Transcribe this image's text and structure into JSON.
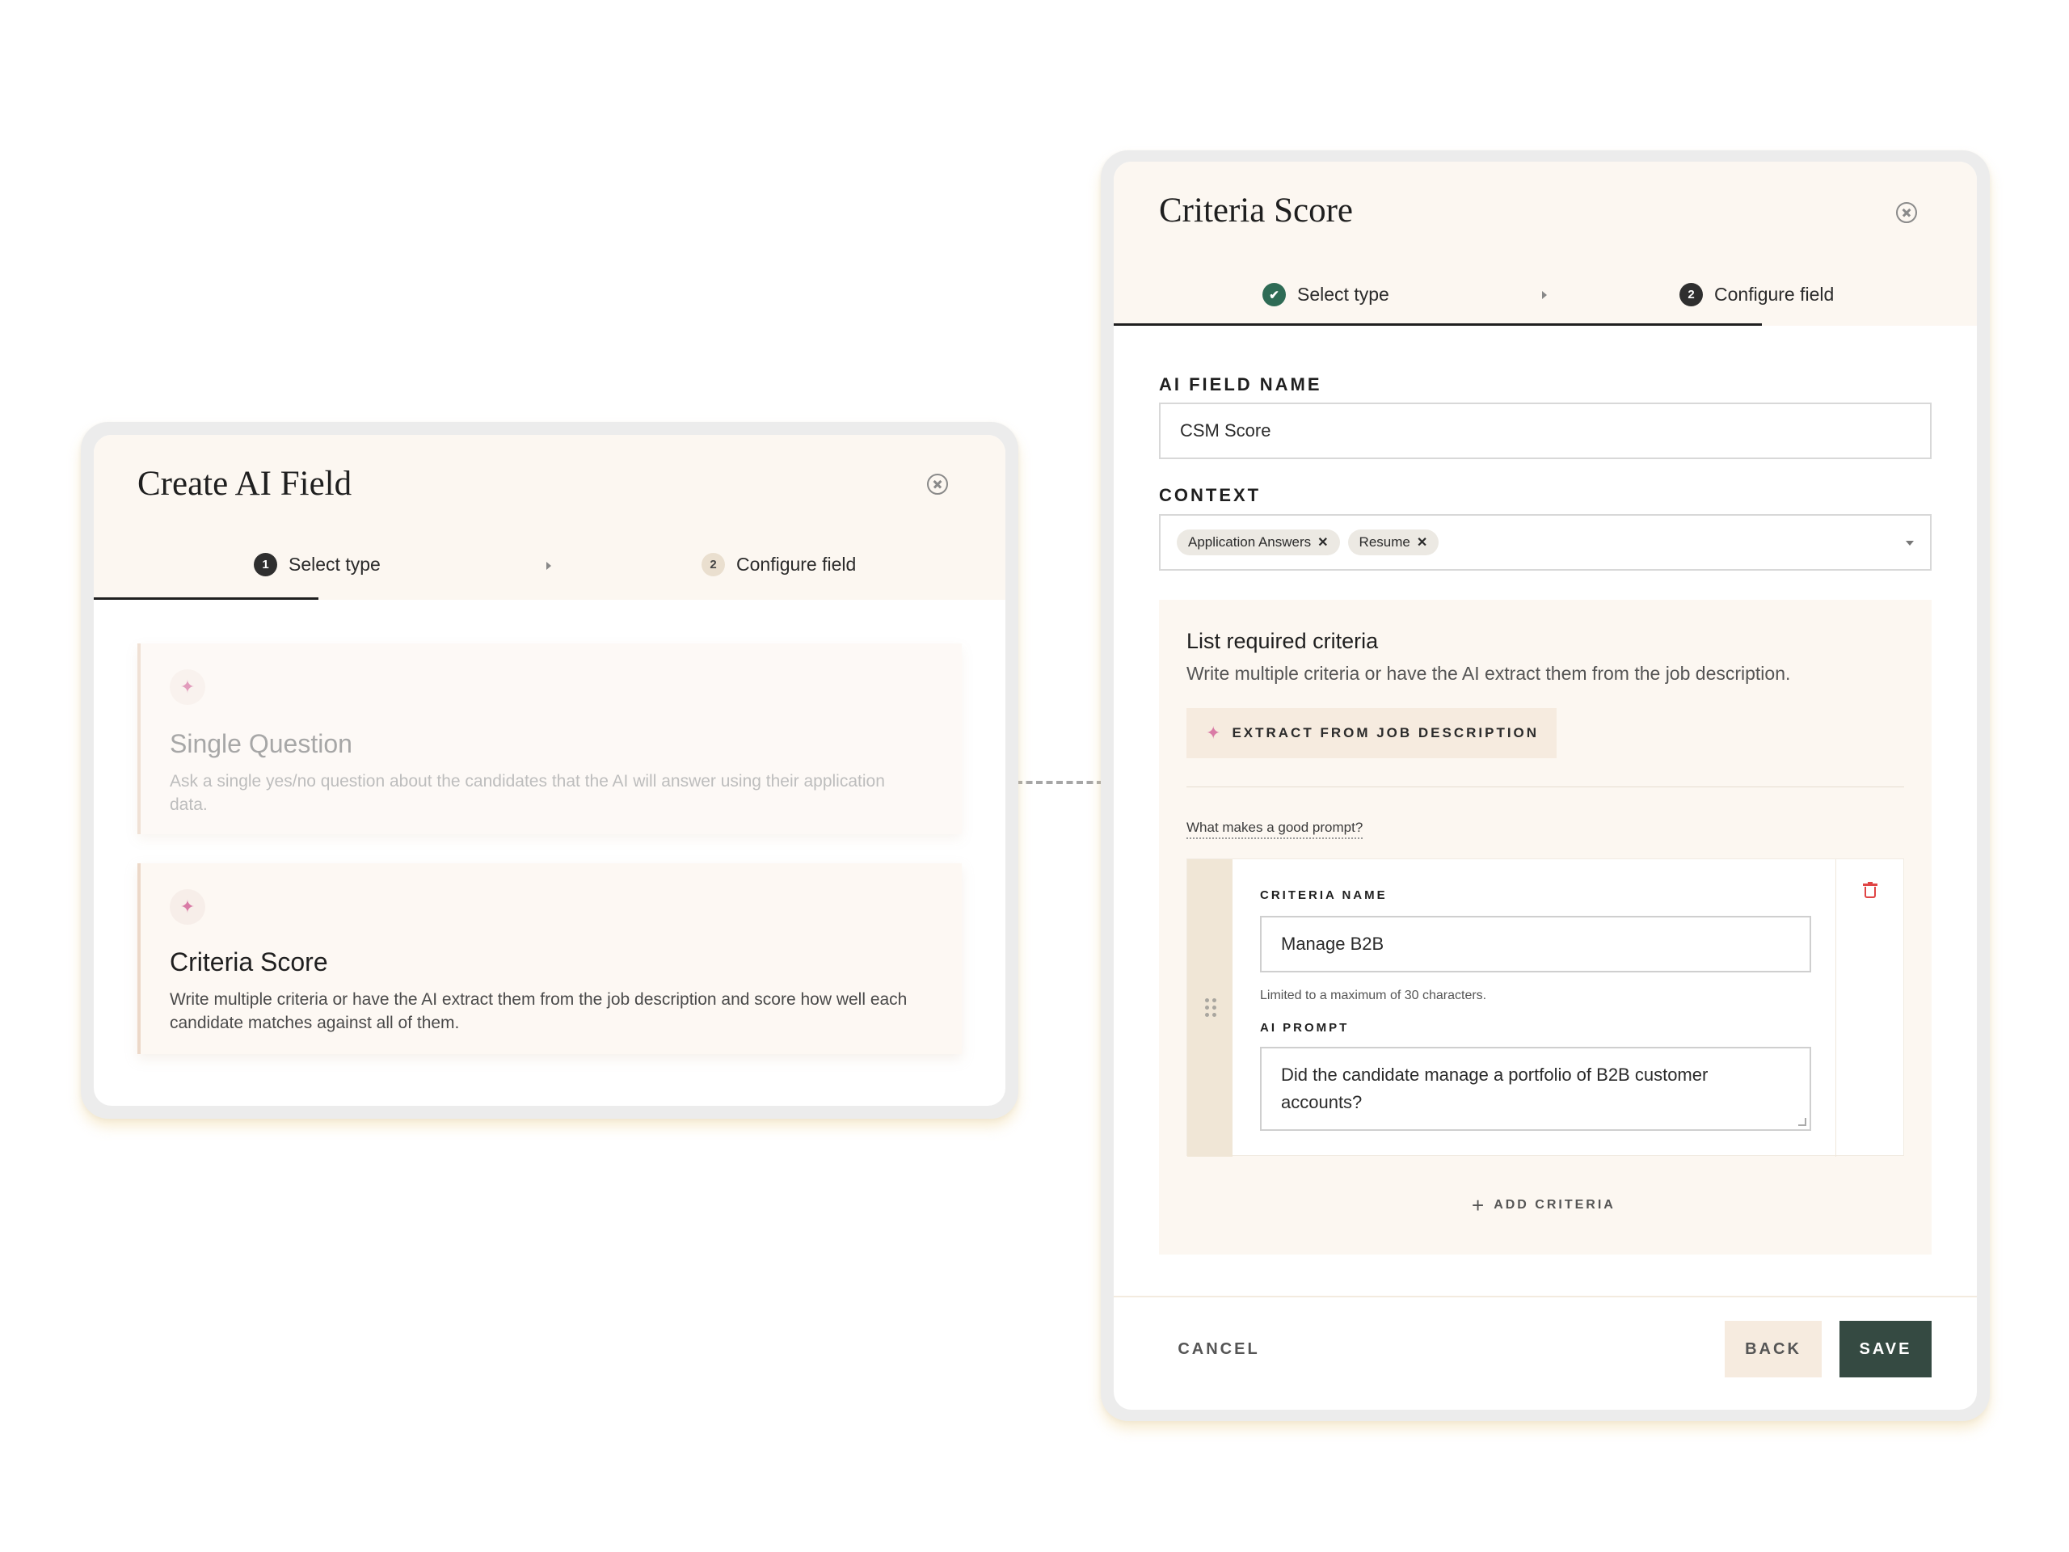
{
  "left_modal": {
    "title": "Create AI Field",
    "steps": [
      {
        "number": "1",
        "label": "Select type"
      },
      {
        "number": "2",
        "label": "Configure field"
      }
    ],
    "cards": [
      {
        "title": "Single Question",
        "description": "Ask a single yes/no question about the candidates that the AI will answer using their application data.",
        "icon": "sparkle-icon"
      },
      {
        "title": "Criteria Score",
        "description": "Write multiple criteria or have the AI extract them from the job description and score how well each candidate matches against all of them.",
        "icon": "sparkle-icon"
      }
    ]
  },
  "right_modal": {
    "title": "Criteria Score",
    "steps": [
      {
        "label": "Select type",
        "state": "done",
        "icon": "check-icon"
      },
      {
        "number": "2",
        "label": "Configure field",
        "state": "active"
      }
    ],
    "ai_field_name": {
      "label": "AI FIELD NAME",
      "value": "CSM Score"
    },
    "context": {
      "label": "CONTEXT",
      "chips": [
        "Application Answers",
        "Resume"
      ],
      "chip_remove_glyph": "✕"
    },
    "criteria_section": {
      "heading": "List required criteria",
      "description": "Write multiple criteria or have the AI extract them from the job description.",
      "extract_button": "EXTRACT FROM JOB DESCRIPTION",
      "help_link": "What makes a good prompt?",
      "criteria": [
        {
          "name_label": "CRITERIA NAME",
          "name_value": "Manage B2B",
          "name_hint": "Limited to a maximum of 30 characters.",
          "prompt_label": "AI PROMPT",
          "prompt_value": "Did the candidate manage a portfolio of B2B customer accounts?"
        }
      ],
      "add_button": "ADD CRITERIA"
    },
    "footer": {
      "cancel": "CANCEL",
      "back": "BACK",
      "save": "SAVE"
    }
  },
  "colors": {
    "accent_dark": "#354a42",
    "success": "#2e6b55",
    "panel": "#fcf7f1",
    "danger": "#e04545",
    "sparkle": "#d97ba6"
  }
}
